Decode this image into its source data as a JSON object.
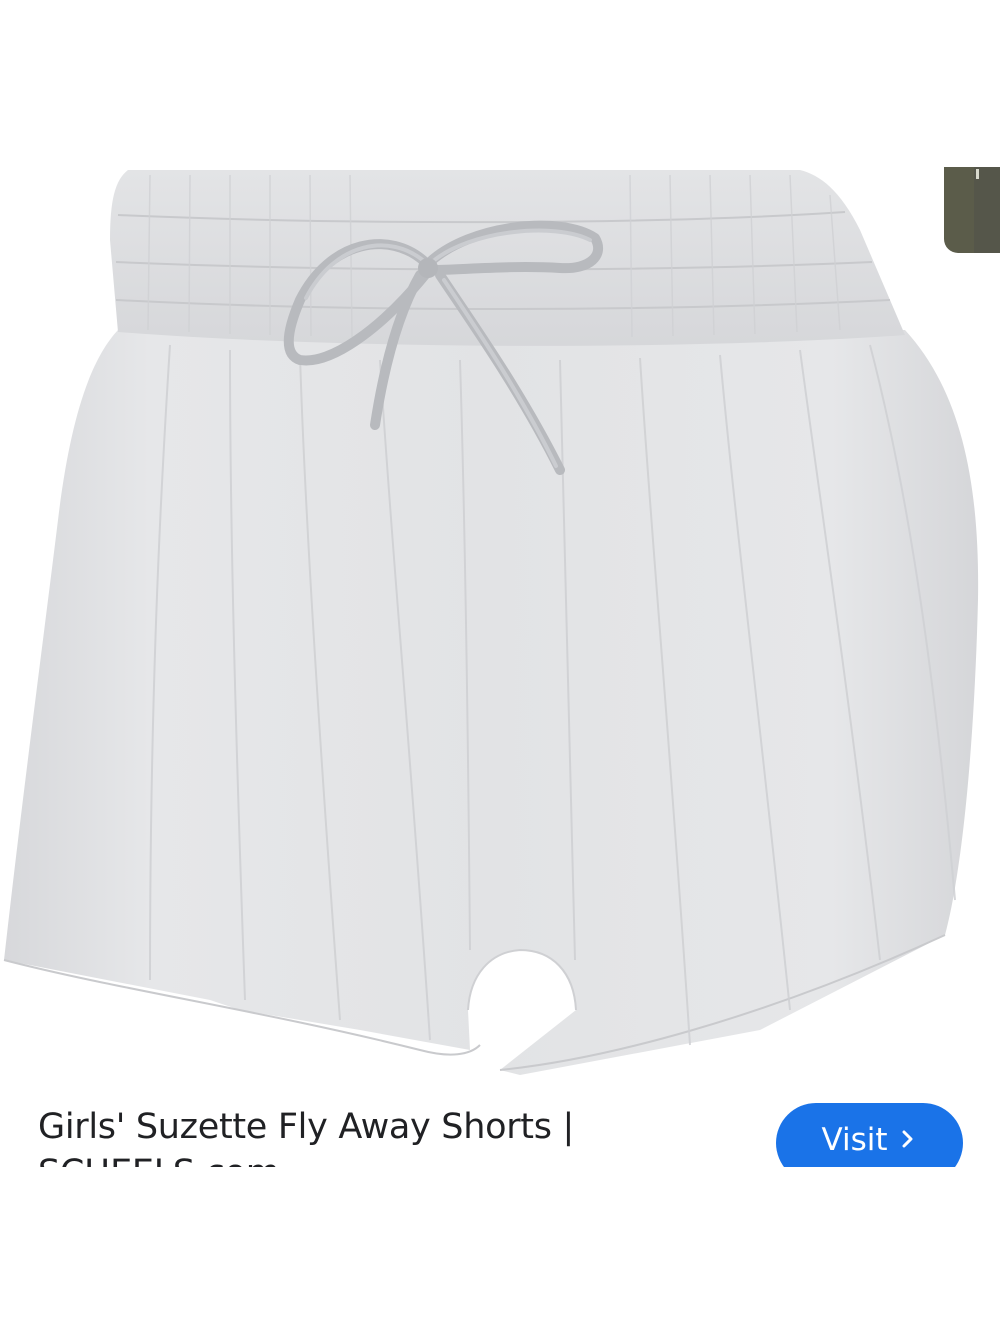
{
  "result": {
    "image": {
      "subject": "light grey flutter shorts with drawstring waist",
      "icon": "product-photo"
    },
    "title": "Girls' Suzette Fly Away Shorts | SCHEELS.com",
    "visit_label": "Visit",
    "visit_icon": "chevron-right-icon"
  },
  "colors": {
    "accent": "#1a73e8",
    "title_text": "#202124",
    "background": "#ffffff",
    "fabric": "#dcdde0",
    "thumb": "#5b5c4a"
  }
}
